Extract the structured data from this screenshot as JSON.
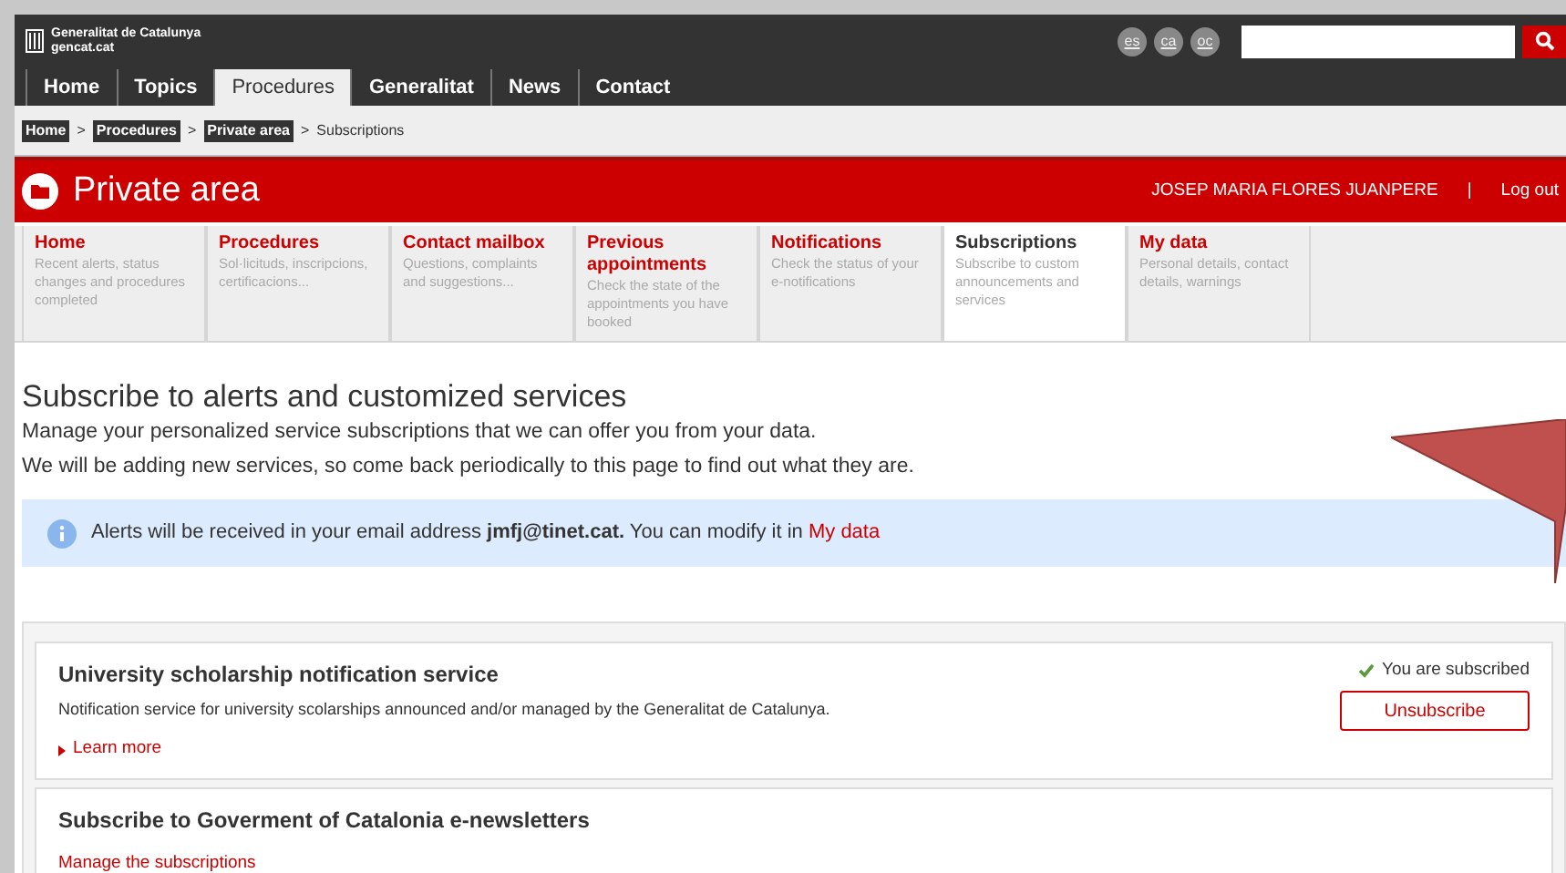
{
  "header": {
    "logo_lines": [
      "Generalitat de Catalunya",
      "gencat.cat"
    ],
    "languages": [
      "es",
      "ca",
      "oc"
    ]
  },
  "nav": [
    {
      "label": "Home",
      "selected": false
    },
    {
      "label": "Topics",
      "selected": false
    },
    {
      "label": "Procedures",
      "selected": true
    },
    {
      "label": "Generalitat",
      "selected": false
    },
    {
      "label": "News",
      "selected": false
    },
    {
      "label": "Contact",
      "selected": false
    }
  ],
  "breadcrumb_separator": ">",
  "breadcrumb": [
    {
      "label": "Home",
      "kind": "link"
    },
    {
      "label": "Procedures",
      "kind": "link"
    },
    {
      "label": "Private area",
      "kind": "link"
    },
    {
      "label": "Subscriptions",
      "kind": "current"
    }
  ],
  "banner": {
    "title": "Private area",
    "user": "JOSEP MARIA FLORES JUANPERE",
    "separator": "|",
    "logout": "Log out"
  },
  "sections": [
    {
      "title": "Home",
      "description": "Recent alerts, status changes and procedures completed",
      "selected": false
    },
    {
      "title": "Procedures",
      "description": "Sol·licituds, inscripcions, certificacions...",
      "selected": false
    },
    {
      "title": "Contact mailbox",
      "description": "Questions, complaints and suggestions...",
      "selected": false
    },
    {
      "title": "Previous appointments",
      "description": "Check the state of the appointments you have booked",
      "selected": false
    },
    {
      "title": "Notifications",
      "description": "Check the status of your e-notifications",
      "selected": false
    },
    {
      "title": "Subscriptions",
      "description": "Subscribe to custom announcements and services",
      "selected": true
    },
    {
      "title": "My data",
      "description": "Personal details, contact details, warnings",
      "selected": false
    }
  ],
  "heading": "Subscribe to alerts and customized services",
  "intro": [
    "Manage your personalized service subscriptions that we can offer you from your data.",
    "We will be adding new services, so come back periodically to this page to find out what they are."
  ],
  "alert": {
    "text": "Alerts will be received in your email address **jmfj@tinet.cat.** You can modify it in",
    "link": "My data"
  },
  "services": [
    {
      "title": "University scholarship notification service",
      "description": "Notification service for university scolarships announced and/or managed by the Generalitat de Catalunya.",
      "link": "Learn more",
      "subscribed": true,
      "status": "You are subscribed",
      "button": "Unsubscribe"
    },
    {
      "title": "Subscribe to Goverment of Catalonia e-newsletters",
      "link": "Manage the subscriptions",
      "subscribed": false
    }
  ]
}
